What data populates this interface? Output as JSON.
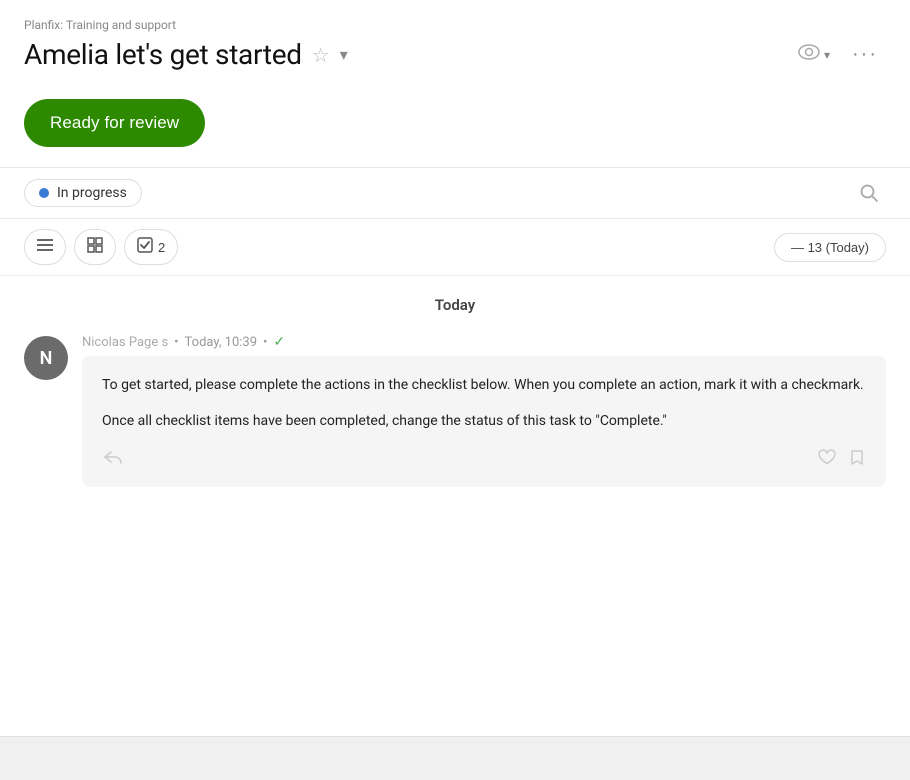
{
  "breadcrumb": "Planfix: Training and support",
  "title": "Amelia let's get started",
  "review_button": "Ready for review",
  "status": {
    "label": "In progress",
    "dot_color": "#3a7bd5"
  },
  "toolbar": {
    "checklist_count": "2",
    "date_label": "— 13 (Today)"
  },
  "feed": {
    "date_label": "Today",
    "item": {
      "author": "Nicolas Page s",
      "timestamp": "Today, 10:39",
      "avatar_letter": "N",
      "message_line1": "To get started, please complete the actions in the checklist below. When you complete an action, mark it with a checkmark.",
      "message_line2": "Once all checklist items have been completed, change the status of this task to \"Complete.\""
    }
  },
  "icons": {
    "star": "☆",
    "chevron_down": "▾",
    "eye": "👁",
    "more": "···",
    "search": "○",
    "list": "≡",
    "table": "⊞",
    "checklist": "☑",
    "reply": "↩",
    "heart": "♡",
    "bookmark": "☆",
    "checkmark": "✓"
  }
}
